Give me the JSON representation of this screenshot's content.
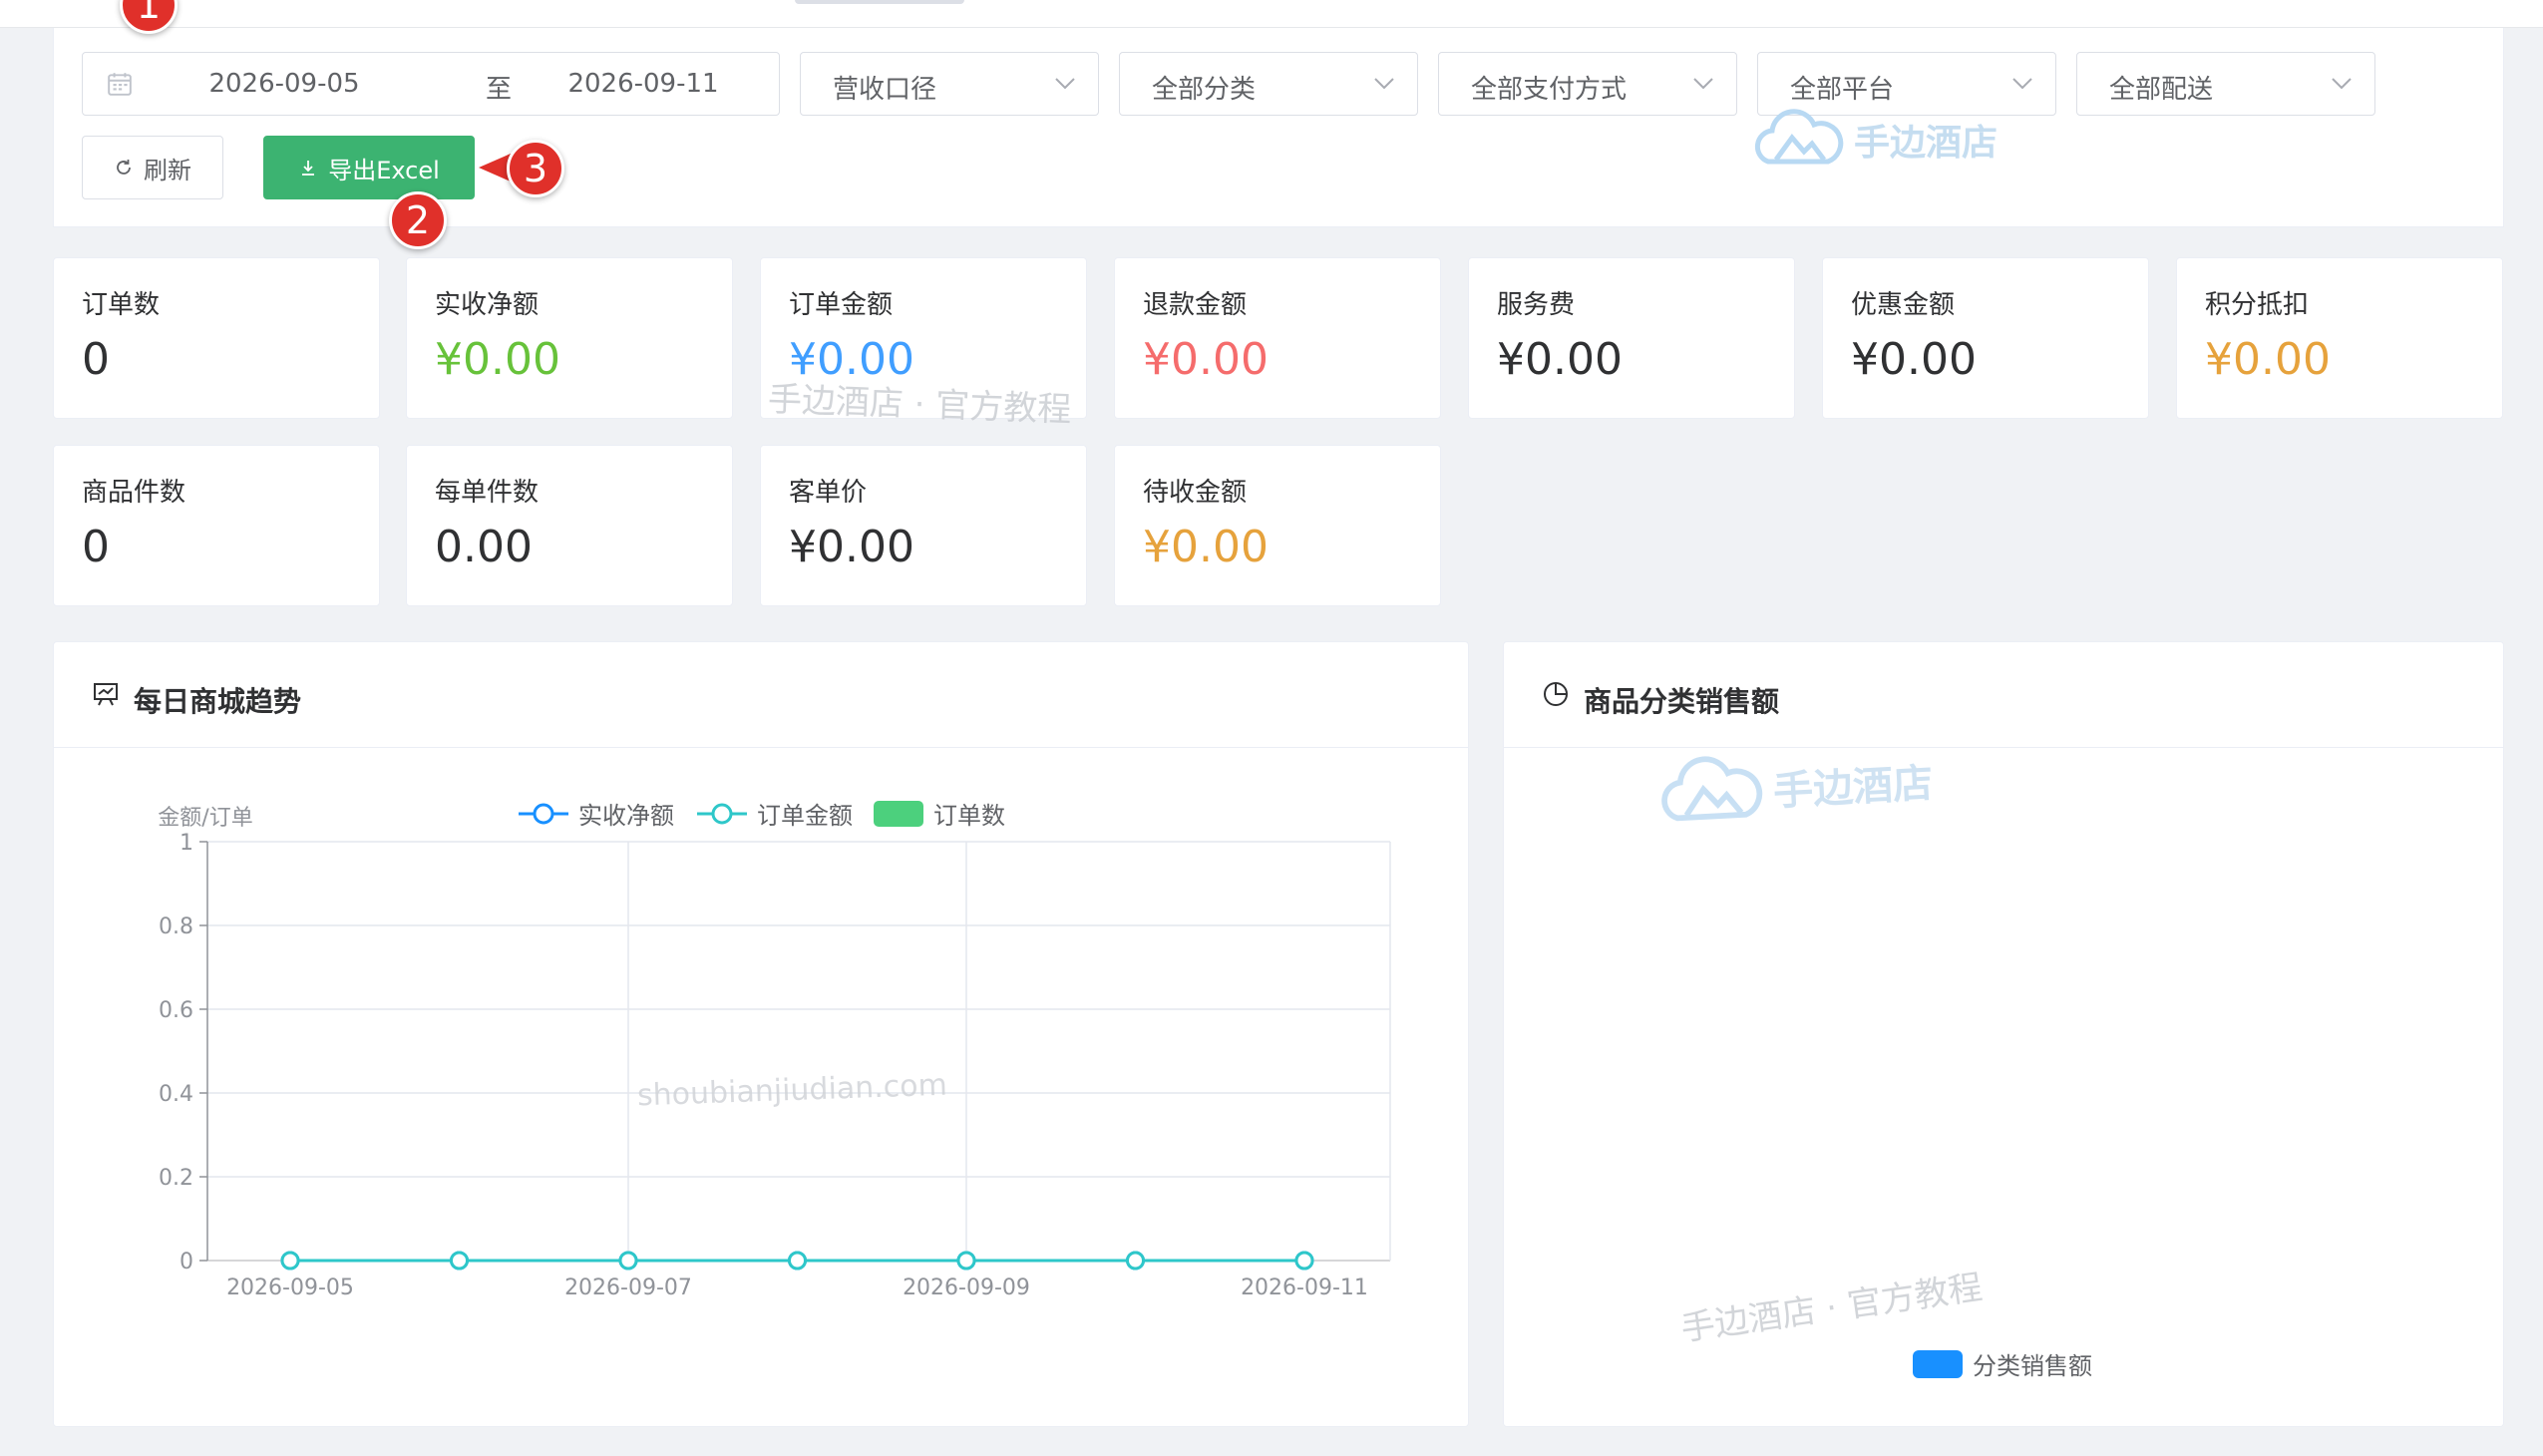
{
  "filters": {
    "date_start": "2026-09-05",
    "date_separator": "至",
    "date_end": "2026-09-11",
    "selects": [
      {
        "label": "营收口径"
      },
      {
        "label": "全部分类"
      },
      {
        "label": "全部支付方式"
      },
      {
        "label": "全部平台"
      },
      {
        "label": "全部配送"
      }
    ],
    "refresh_label": "刷新",
    "export_label": "导出Excel"
  },
  "markers": [
    "1",
    "2",
    "3"
  ],
  "watermarks": {
    "logo_text": "手边酒店",
    "tutorial": "手边酒店 · 官方教程",
    "domain": "shoubianjiudian.com"
  },
  "stats_row1": [
    {
      "label": "订单数",
      "value": "0",
      "color": "#303133"
    },
    {
      "label": "实收净额",
      "value": "¥0.00",
      "color": "#67c23a"
    },
    {
      "label": "订单金额",
      "value": "¥0.00",
      "color": "#409eff"
    },
    {
      "label": "退款金额",
      "value": "¥0.00",
      "color": "#f56c6c"
    },
    {
      "label": "服务费",
      "value": "¥0.00",
      "color": "#303133"
    },
    {
      "label": "优惠金额",
      "value": "¥0.00",
      "color": "#303133"
    },
    {
      "label": "积分抵扣",
      "value": "¥0.00",
      "color": "#e6a23c"
    }
  ],
  "stats_row2": [
    {
      "label": "商品件数",
      "value": "0",
      "color": "#303133"
    },
    {
      "label": "每单件数",
      "value": "0.00",
      "color": "#303133"
    },
    {
      "label": "客单价",
      "value": "¥0.00",
      "color": "#303133"
    },
    {
      "label": "待收金额",
      "value": "¥0.00",
      "color": "#e6a23c"
    }
  ],
  "trend_panel": {
    "title": "每日商城趋势",
    "icon": "presentation-chart-icon"
  },
  "category_panel": {
    "title": "商品分类销售额",
    "icon": "pie-chart-icon",
    "legend": "分类销售额",
    "legend_color": "#1890ff"
  },
  "chart_data": [
    {
      "type": "line",
      "ylabel": "金额/订单",
      "ylim": [
        0,
        1
      ],
      "y_ticks": [
        "0",
        "0.2",
        "0.4",
        "0.6",
        "0.8",
        "1"
      ],
      "x": [
        "2026-09-05",
        "2026-09-06",
        "2026-09-07",
        "2026-09-08",
        "2026-09-09",
        "2026-09-10",
        "2026-09-11"
      ],
      "x_tick_labels": [
        "2026-09-05",
        "2026-09-07",
        "2026-09-09",
        "2026-09-11"
      ],
      "grid": true,
      "legend_position": "top-center",
      "series": [
        {
          "name": "实收净额",
          "type": "line",
          "color": "#1890ff",
          "values": [
            0,
            0,
            0,
            0,
            0,
            0,
            0
          ]
        },
        {
          "name": "订单金额",
          "type": "line",
          "color": "#2ec7c9",
          "values": [
            0,
            0,
            0,
            0,
            0,
            0,
            0
          ]
        },
        {
          "name": "订单数",
          "type": "bar",
          "color": "#4cd07d",
          "values": [
            0,
            0,
            0,
            0,
            0,
            0,
            0
          ]
        }
      ]
    },
    {
      "type": "pie",
      "series": [
        {
          "name": "分类销售额",
          "values": []
        }
      ],
      "legend_position": "bottom-center"
    }
  ]
}
